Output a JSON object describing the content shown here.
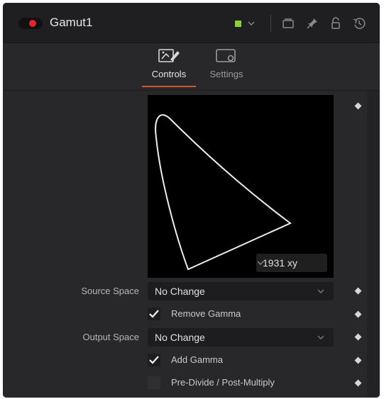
{
  "header": {
    "node_name": "Gamut1",
    "toggle_state": "on",
    "node_color": "#8bd22a"
  },
  "tabs": [
    {
      "label": "Controls",
      "icon": "controls-icon",
      "active": true
    },
    {
      "label": "Settings",
      "icon": "settings-icon",
      "active": false
    }
  ],
  "diagram": {
    "mode_label": "1931 xy",
    "curve_icon": "chromaticity-diagram"
  },
  "controls": {
    "source_space": {
      "label": "Source Space",
      "value": "No Change"
    },
    "remove_gamma": {
      "label": "Remove Gamma",
      "checked": true
    },
    "output_space": {
      "label": "Output Space",
      "value": "No Change"
    },
    "add_gamma": {
      "label": "Add Gamma",
      "checked": true
    },
    "pre_divide": {
      "label": "Pre-Divide / Post-Multiply",
      "checked": false
    }
  },
  "colors": {
    "accent": "#d9542b",
    "toggle_red": "#e3242b",
    "panel_bg": "#28282a"
  }
}
